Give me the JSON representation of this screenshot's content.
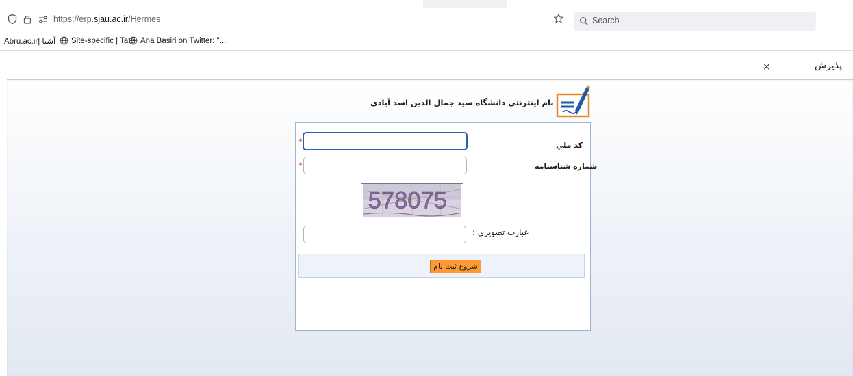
{
  "browser": {
    "url_prefix": "https://erp.",
    "url_domain": "sjau.ac.ir",
    "url_path": "/Hermes",
    "search_placeholder": "Search"
  },
  "bookmarks": {
    "items": [
      "Abru.ac.ir| آشنا",
      "Site-specific | Tate",
      "Ana Basiri on Twitter: \"..."
    ]
  },
  "page_tab": {
    "label": "پذیرش",
    "close": "×"
  },
  "header": {
    "title": "ثبت نام اینترنتی دانشگاه سید جمال الدین اسد آبادی"
  },
  "form": {
    "national_code_label": "کد ملي",
    "national_code_value": "",
    "id_number_label": "شماره شناسنامه",
    "id_number_value": "",
    "required_mark": "*",
    "captcha_text": "578075",
    "captcha_label": "عبارت تصویری :",
    "captcha_value": "",
    "submit_label": "شروع ثبت نام"
  },
  "colors": {
    "accent_orange": "#ff9933",
    "focus_blue": "#2b5fb8",
    "panel_border": "#9fb4cf"
  }
}
